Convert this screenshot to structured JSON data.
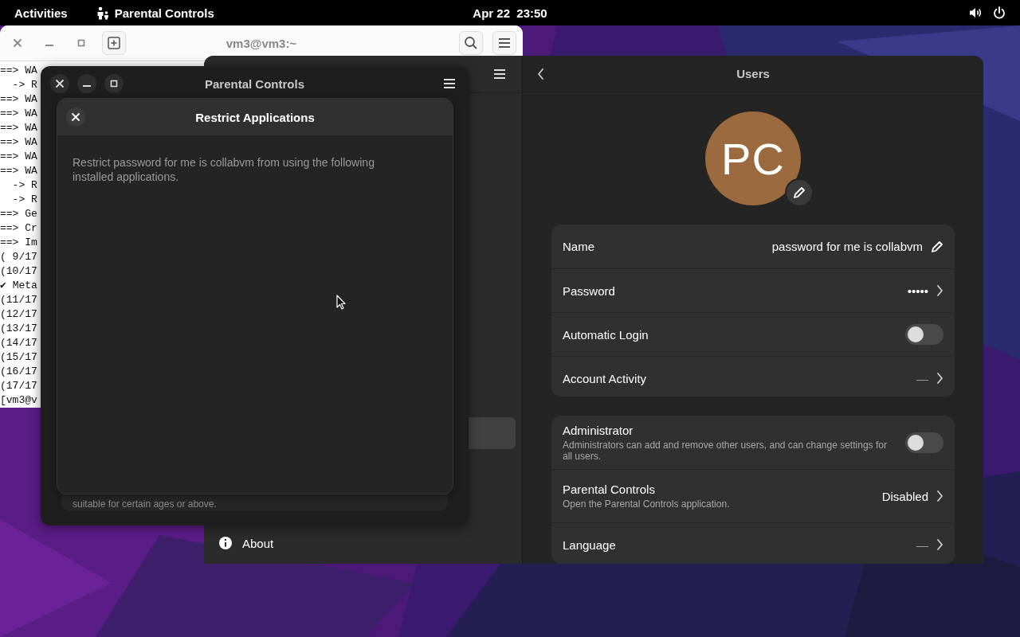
{
  "top_bar": {
    "activities": "Activities",
    "app_name": "Parental Controls",
    "clock": "Apr 22  23:50"
  },
  "terminal": {
    "title": "vm3@vm3:~",
    "lines": [
      "==> WA",
      "  -> R",
      "==> WA",
      "==> WA",
      "==> WA",
      "==> WA",
      "==> WA",
      "==> WA",
      "  -> R",
      "  -> R",
      "==> Ge",
      "==> Cr",
      "==> Im",
      "( 9/17",
      "(10/17",
      "✔ Meta",
      "(11/17",
      "(12/17",
      "(13/17",
      "(14/17",
      "(15/17",
      "(16/17",
      "(17/17",
      "[vm3@v"
    ]
  },
  "settings": {
    "sidebar": {
      "items": [
        {
          "selected": true
        },
        {
          "label": "About",
          "selected": false
        }
      ]
    },
    "users": {
      "title": "Users",
      "avatar_initials": "PC",
      "groups": [
        {
          "rows": [
            {
              "kind": "edit",
              "label": "Name",
              "value": "password for me is collabvm"
            },
            {
              "kind": "link",
              "label": "Password",
              "value": "•••••"
            },
            {
              "kind": "switch",
              "label": "Automatic Login",
              "on": false
            },
            {
              "kind": "link",
              "label": "Account Activity",
              "value": "—"
            }
          ]
        },
        {
          "rows": [
            {
              "kind": "switch",
              "label": "Administrator",
              "subtitle": "Administrators can add and remove other users, and can change settings for all users.",
              "on": false
            },
            {
              "kind": "link",
              "label": "Parental Controls",
              "subtitle": "Open the Parental Controls application.",
              "value": "Disabled"
            },
            {
              "kind": "link",
              "label": "Language",
              "value": "—"
            }
          ]
        }
      ]
    }
  },
  "parental_controls": {
    "title": "Parental Controls",
    "card_text": "suitable for certain ages or above.",
    "dialog": {
      "title": "Restrict Applications",
      "description": "Restrict password for me is collabvm from using the following installed applications."
    }
  }
}
